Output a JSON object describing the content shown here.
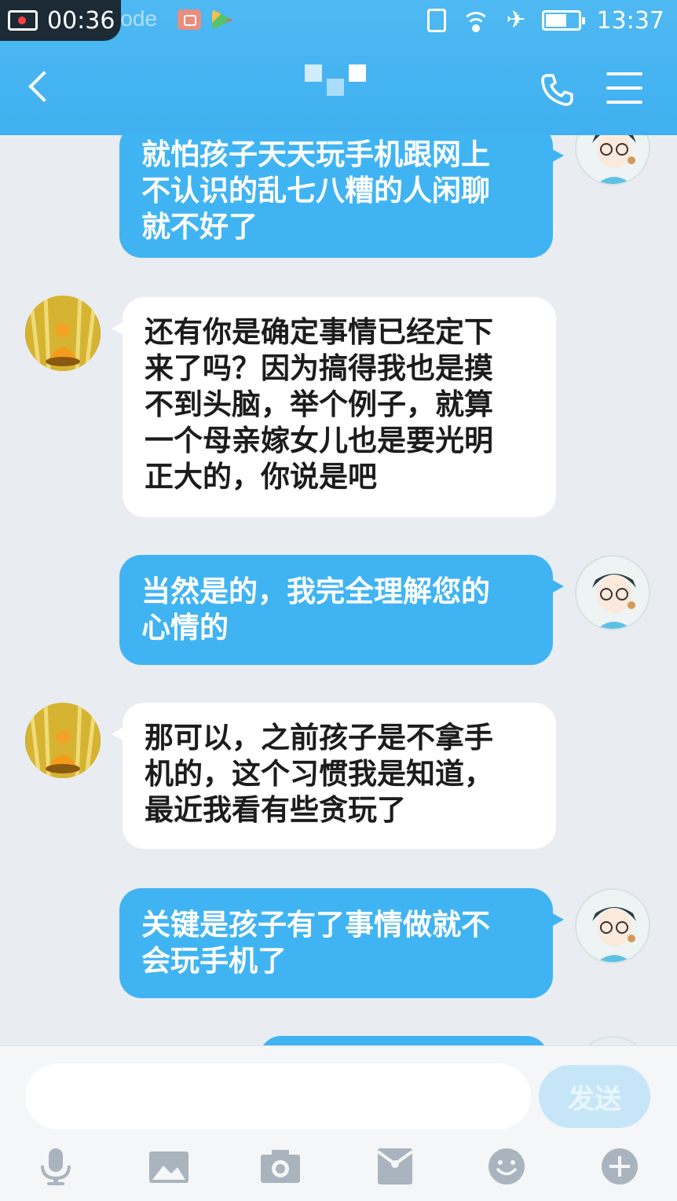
{
  "status_bar": {
    "recording_time": "00:36",
    "mode_text": "mode",
    "clock": "13:37",
    "icons": [
      "screen-record-icon",
      "vibrate-icon",
      "wifi-icon",
      "airplane-icon",
      "battery-icon"
    ]
  },
  "header": {
    "contact_name": "███",
    "back_icon": "chevron-left-icon",
    "call_icon": "phone-icon",
    "menu_icon": "hamburger-menu-icon"
  },
  "messages": [
    {
      "side": "out",
      "lines": [
        "就怕孩子天天玩手机跟网上",
        "不认识的乱七八糟的人闲聊",
        "就不好了"
      ]
    },
    {
      "side": "in",
      "lines": [
        "还有你是确定事情已经定下",
        "来了吗？因为搞得我也是摸",
        "不到头脑，举个例子，就算",
        "一个母亲嫁女儿也是要光明",
        "正大的，你说是吧"
      ]
    },
    {
      "side": "out",
      "lines": [
        "当然是的，我完全理解您的",
        "心情的"
      ]
    },
    {
      "side": "in",
      "lines": [
        "那可以，之前孩子是不拿手",
        "机的，这个习惯我是知道，",
        "最近我看有些贪玩了"
      ]
    },
    {
      "side": "out",
      "lines": [
        "关键是孩子有了事情做就不",
        "会玩手机了"
      ]
    }
  ],
  "composer": {
    "input_value": "",
    "send_label": "发送"
  },
  "toolbar": {
    "icons": [
      "microphone-icon",
      "image-icon",
      "camera-icon",
      "red-packet-icon",
      "emoji-icon",
      "plus-icon"
    ]
  },
  "colors": {
    "header": "#40b4f2",
    "outgoing_bubble": "#40b4f2",
    "incoming_bubble": "#ffffff",
    "chat_background": "#e9edf2",
    "toolbar_icon": "#a9b4be"
  }
}
